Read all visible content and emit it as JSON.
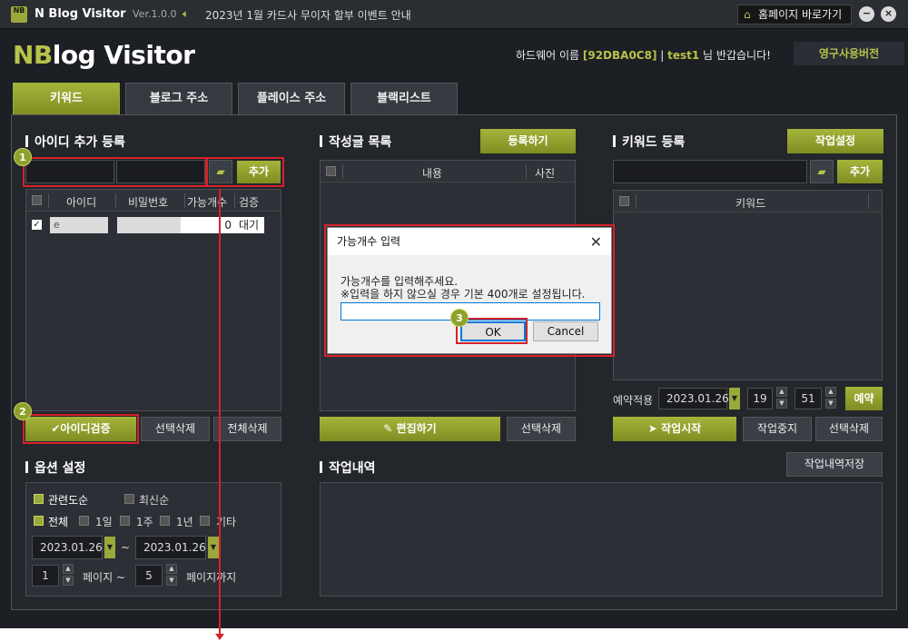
{
  "titlebar": {
    "logo": "NB",
    "app_name": "N Blog Visitor",
    "version": "Ver.1.0.0",
    "notice": "2023년 1월 카드사 무이자 할부 이벤트 안내",
    "home_button": "홈페이지 바로가기",
    "minimize": "−",
    "close": "×"
  },
  "header": {
    "brand_prefix": "NB",
    "brand_rest": "log Visitor",
    "user_prefix": "하드웨어 이름 ",
    "hardware_id": "[92DBA0C8]",
    "user_sep": " | ",
    "username": "test1",
    "user_suffix": " 님 반갑습니다!",
    "license_button": "영구사용버전"
  },
  "tabs": [
    {
      "label": "키워드",
      "active": true
    },
    {
      "label": "블로그 주소",
      "active": false
    },
    {
      "label": "플레이스 주소",
      "active": false
    },
    {
      "label": "블랙리스트",
      "active": false
    }
  ],
  "id_section": {
    "title": "아이디 추가 등록",
    "add_button": "추가",
    "columns": [
      "아이디",
      "비밀번호",
      "가능개수",
      "검증"
    ],
    "rows": [
      {
        "id": "e",
        "password": "",
        "count": "0",
        "status": "대기"
      }
    ],
    "verify_button": "아이디검증",
    "delete_selected": "선택삭제",
    "delete_all": "전체삭제"
  },
  "posts_section": {
    "title": "작성글 목록",
    "register_button": "등록하기",
    "columns": [
      "내용",
      "사진"
    ],
    "edit_button": "편집하기",
    "delete_selected": "선택삭제"
  },
  "keyword_section": {
    "title": "키워드 등록",
    "settings_button": "작업설정",
    "add_button": "추가",
    "columns": [
      "키워드"
    ],
    "schedule_label": "예약적용",
    "schedule_date": "2023.01.26",
    "schedule_hour": "19",
    "schedule_minute": "51",
    "reserve_button": "예약",
    "start_button": "작업시작",
    "stop_button": "작업중지",
    "delete_selected": "선택삭제"
  },
  "options_section": {
    "title": "옵션 설정",
    "sort_options": [
      {
        "label": "관련도순",
        "checked": true
      },
      {
        "label": "최신순",
        "checked": false
      }
    ],
    "period_options": [
      {
        "label": "전체",
        "checked": true
      },
      {
        "label": "1일",
        "checked": false
      },
      {
        "label": "1주",
        "checked": false
      },
      {
        "label": "1년",
        "checked": false
      },
      {
        "label": "기타",
        "checked": false
      }
    ],
    "date_from": "2023.01.26",
    "date_tilde": "~",
    "date_to": "2023.01.26",
    "page_from": "1",
    "page_label_from": "페이지 ~",
    "page_to": "5",
    "page_label_to": "페이지까지"
  },
  "log_section": {
    "title": "작업내역",
    "save_button": "작업내역저장"
  },
  "dialog": {
    "title": "가능개수 입력",
    "message1": "가능개수를 입력해주세요.",
    "message2": "※입력을 하지 않으실 경우 기본 400개로 설정됩니다.",
    "input_value": "",
    "ok": "OK",
    "cancel": "Cancel"
  },
  "steps": [
    "1",
    "2",
    "3"
  ],
  "colors": {
    "accent": "#9aa93a",
    "background": "#1c1f24",
    "highlight": "#d5222c"
  }
}
